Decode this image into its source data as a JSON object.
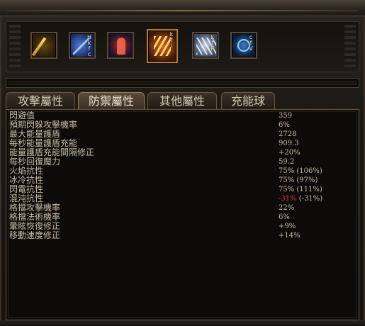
{
  "skills": [
    {
      "name": "gem-1",
      "label": ""
    },
    {
      "name": "gem-2",
      "label": "H\nk\nf\nc"
    },
    {
      "name": "gem-3",
      "label": ""
    },
    {
      "name": "gem-4",
      "label": "k\nf\ni"
    },
    {
      "name": "gem-5",
      "label": "k\nf\nR"
    },
    {
      "name": "gem-6",
      "label": "c\nf\nV"
    }
  ],
  "tabs": {
    "offense": "攻擊屬性",
    "defense": "防禦屬性",
    "other": "其他屬性",
    "charges": "充能球"
  },
  "stats": [
    {
      "label": "閃避值",
      "value": "359"
    },
    {
      "label": "預期閃躲攻擊機率",
      "value": "6%"
    },
    {
      "label": "最大能量護盾",
      "value": "2728"
    },
    {
      "label": "每秒能量護盾充能",
      "value": "909.3"
    },
    {
      "label": "能量護盾充能間隔修正",
      "value": "+20%"
    },
    {
      "label": "每秒回復魔力",
      "value": "59.2"
    },
    {
      "label": "火焰抗性",
      "value": "75% (106%)"
    },
    {
      "label": "冰冷抗性",
      "value": "75% (97%)"
    },
    {
      "label": "閃電抗性",
      "value": "75% (111%)"
    },
    {
      "label": "混沌抗性",
      "value_neg": "-31%",
      "value_rest": " (-31%)"
    },
    {
      "label": "格擋攻擊機率",
      "value": "22%"
    },
    {
      "label": "格擋法術機率",
      "value": "6%"
    },
    {
      "label": "暈眩恢復修正",
      "value": "+9%"
    },
    {
      "label": "移動速度修正",
      "value": "+14%"
    }
  ]
}
